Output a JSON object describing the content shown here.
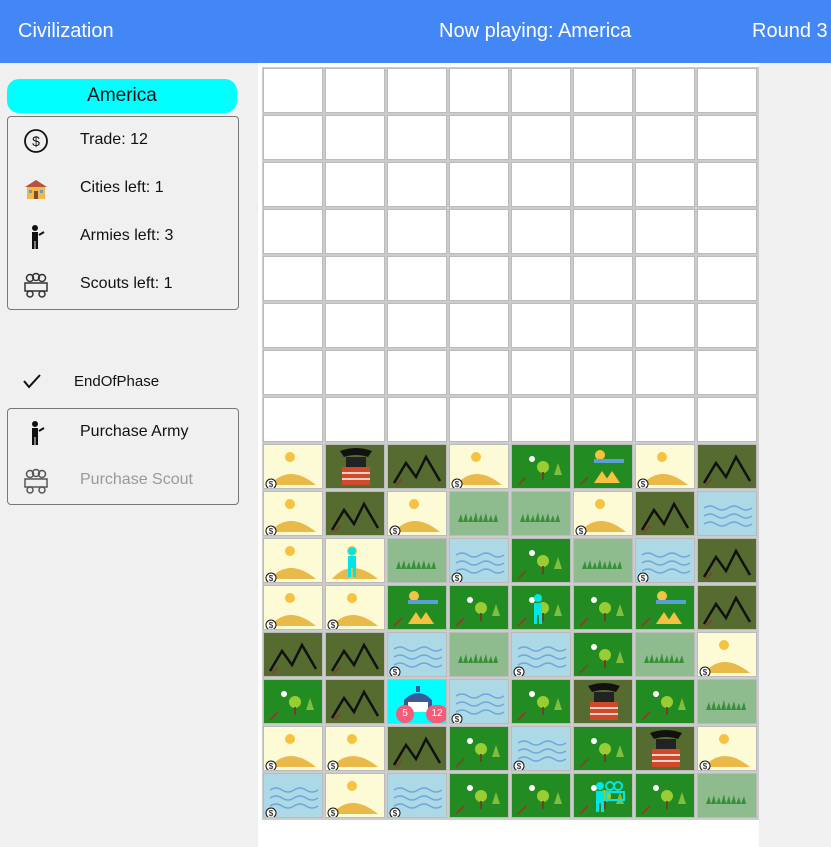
{
  "header": {
    "app_title": "Civilization",
    "now_playing": "Now playing: America",
    "round": "Round 3"
  },
  "player": {
    "civ_name": "America",
    "color": "#00ffff",
    "stats": [
      {
        "icon": "dollar-icon",
        "label": "Trade: 12"
      },
      {
        "icon": "house-icon",
        "label": "Cities left: 1"
      },
      {
        "icon": "soldier-icon",
        "label": "Armies left: 3"
      },
      {
        "icon": "wagon-icon",
        "label": "Scouts left: 1"
      }
    ]
  },
  "actions": {
    "end_of_phase": "EndOfPhase",
    "purchase_army": "Purchase Army",
    "purchase_scout": "Purchase Scout"
  },
  "colors": {
    "header_bg": "#4287f5",
    "desert": "#fcfbd6",
    "mountain": "#556b2f",
    "forest": "#228b22",
    "grassland": "#8fbc8f",
    "water": "#add8e6",
    "capital": "#00ffff"
  },
  "city": {
    "left_badge": "5",
    "right_badge": "12"
  },
  "board": {
    "hidden_rows": 8,
    "visible_rows": [
      [
        "desert$",
        "samurai",
        "mountain",
        "desert$",
        "forest",
        "grass-tent",
        "desert$",
        "mountain"
      ],
      [
        "desert$",
        "mountain",
        "desert$",
        "grassland",
        "grassland",
        "desert$",
        "mountain",
        "water"
      ],
      [
        "desert$",
        "desert-army",
        "grassland",
        "water$",
        "forest",
        "grassland",
        "water$",
        "mountain"
      ],
      [
        "desert$",
        "desert$",
        "grass-tent",
        "forest",
        "forest-army",
        "forest",
        "grass-tent",
        "mountain"
      ],
      [
        "mountain",
        "mountain",
        "water$",
        "grassland",
        "water$",
        "forest",
        "grassland",
        "desert$"
      ],
      [
        "forest",
        "mountain",
        "city",
        "water$",
        "forest",
        "samurai",
        "forest",
        "grassland"
      ],
      [
        "desert$",
        "desert$",
        "mountain",
        "forest",
        "water$",
        "forest",
        "samurai",
        "desert$"
      ],
      [
        "water$",
        "desert$",
        "water$",
        "forest",
        "forest",
        "forest-scout",
        "forest",
        "grassland"
      ]
    ]
  }
}
